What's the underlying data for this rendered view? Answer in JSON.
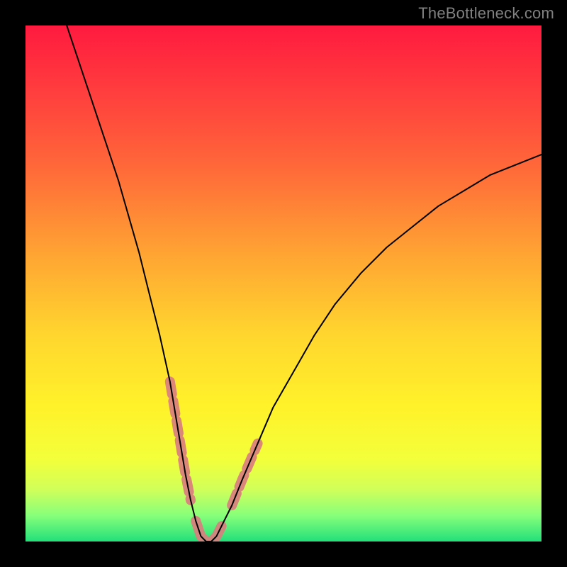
{
  "watermark": "TheBottleneck.com",
  "colors": {
    "frame": "#000000",
    "watermark": "#808080",
    "curve": "#000000",
    "highlight": "#d97e7e",
    "gradient_stops": [
      {
        "offset": 0.0,
        "color": "#ff1a3f"
      },
      {
        "offset": 0.12,
        "color": "#ff3b3e"
      },
      {
        "offset": 0.28,
        "color": "#ff6a39"
      },
      {
        "offset": 0.44,
        "color": "#ffa333"
      },
      {
        "offset": 0.6,
        "color": "#ffd62e"
      },
      {
        "offset": 0.74,
        "color": "#fff22a"
      },
      {
        "offset": 0.84,
        "color": "#f3ff3a"
      },
      {
        "offset": 0.9,
        "color": "#d0ff5a"
      },
      {
        "offset": 0.95,
        "color": "#86ff7a"
      },
      {
        "offset": 1.0,
        "color": "#22e07a"
      }
    ]
  },
  "chart_data": {
    "type": "line",
    "title": "",
    "xlabel": "",
    "ylabel": "",
    "xlim": [
      0,
      100
    ],
    "ylim": [
      0,
      100
    ],
    "grid": false,
    "series": [
      {
        "name": "bottleneck-curve",
        "x": [
          8,
          10,
          12,
          14,
          16,
          18,
          20,
          22,
          24,
          26,
          28,
          29,
          30,
          31,
          32,
          33,
          34,
          35,
          36,
          37,
          38,
          40,
          42,
          45,
          48,
          52,
          56,
          60,
          65,
          70,
          75,
          80,
          85,
          90,
          95,
          100
        ],
        "y": [
          100,
          94,
          88,
          82,
          76,
          70,
          63,
          56,
          48,
          40,
          31,
          25,
          19,
          13,
          8,
          4,
          1,
          0,
          0,
          1,
          3,
          7,
          12,
          19,
          26,
          33,
          40,
          46,
          52,
          57,
          61,
          65,
          68,
          71,
          73,
          75
        ]
      }
    ],
    "highlighted_range_x": [
      27,
      45
    ],
    "annotations": []
  }
}
